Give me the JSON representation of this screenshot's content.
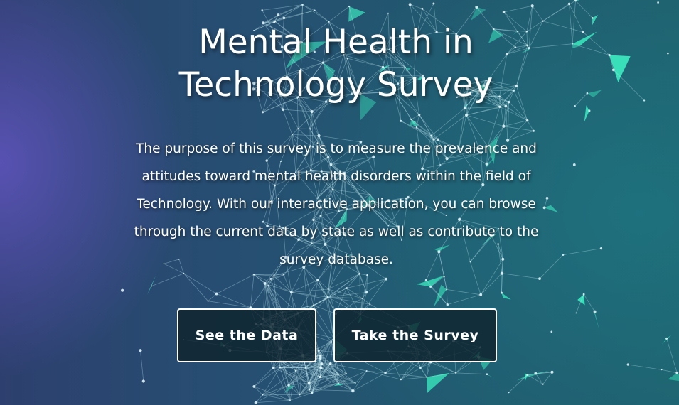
{
  "hero": {
    "title": "Mental Health in Technology Survey",
    "description": "The purpose of this survey is to measure the prevalence and attitudes toward mental health disorders within the field of Technology. With our interactive application, you can browse through the current data by state as well as contribute to the survey database."
  },
  "actions": {
    "see_data_label": "See the Data",
    "take_survey_label": "Take the Survey"
  },
  "colors": {
    "background": "#274d72",
    "network_accent": "#3ff0c0",
    "button_border": "#ffffff",
    "button_fill": "#0f232d",
    "text": "#ffffff"
  }
}
